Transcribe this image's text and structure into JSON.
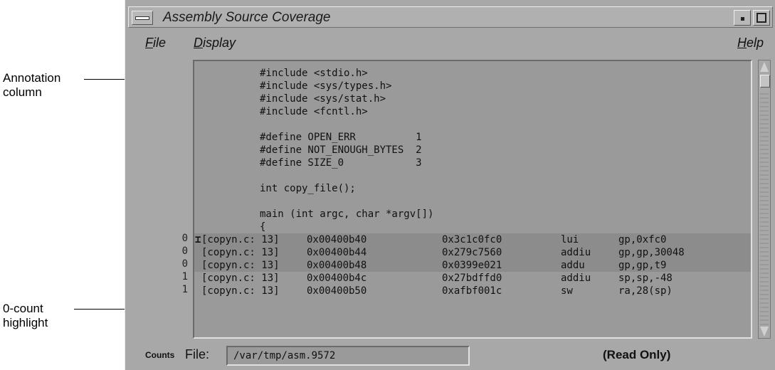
{
  "callouts": {
    "annotation_column": [
      "Annotation",
      "column"
    ],
    "zero_count_highlight": [
      "0-count",
      "highlight"
    ]
  },
  "window": {
    "title": "Assembly Source Coverage"
  },
  "menubar": {
    "file": {
      "mnemonic": "F",
      "rest": "ile"
    },
    "display": {
      "mnemonic": "D",
      "rest": "isplay"
    },
    "help": {
      "mnemonic": "H",
      "rest": "elp"
    }
  },
  "source_lines": [
    "#include <stdio.h>",
    "#include <sys/types.h>",
    "#include <sys/stat.h>",
    "#include <fcntl.h>",
    "",
    "#define OPEN_ERR          1",
    "#define NOT_ENOUGH_BYTES  2",
    "#define SIZE_0            3",
    "",
    "int copy_file();",
    "",
    "main (int argc, char *argv[])",
    "{"
  ],
  "asm_lines": [
    {
      "count": "0",
      "file": "[copyn.c: 13]",
      "addr": "0x00400b40",
      "code": "0x3c1c0fc0",
      "op": "lui",
      "args": "gp,0xfc0",
      "highlight": true
    },
    {
      "count": "0",
      "file": "[copyn.c: 13]",
      "addr": "0x00400b44",
      "code": "0x279c7560",
      "op": "addiu",
      "args": "gp,gp,30048",
      "highlight": true
    },
    {
      "count": "0",
      "file": "[copyn.c: 13]",
      "addr": "0x00400b48",
      "code": "0x0399e021",
      "op": "addu",
      "args": "gp,gp,t9",
      "highlight": true
    },
    {
      "count": "1",
      "file": "[copyn.c: 13]",
      "addr": "0x00400b4c",
      "code": "0x27bdffd0",
      "op": "addiu",
      "args": "sp,sp,-48",
      "highlight": false
    },
    {
      "count": "1",
      "file": "[copyn.c: 13]",
      "addr": "0x00400b50",
      "code": "0xafbf001c",
      "op": "sw",
      "args": "ra,28(sp)",
      "highlight": false
    }
  ],
  "statusbar": {
    "counts_label": "Counts",
    "file_label": "File:",
    "file_value": "/var/tmp/asm.9572",
    "readonly": "(Read Only)"
  },
  "colors": {
    "window_bg": "#a8a8a8",
    "pane_bg": "#9a9a9a",
    "zero_count_highlight": "#8c8c8c"
  }
}
